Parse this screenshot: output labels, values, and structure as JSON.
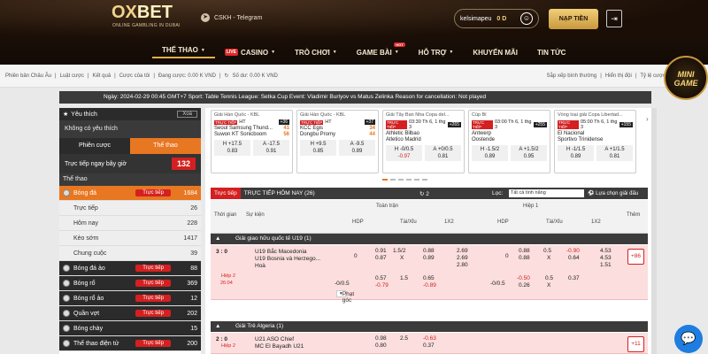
{
  "header": {
    "logo_a": "OX",
    "logo_b": "BET",
    "logo_sub": "ONLINE GAMBLING IN DUBAI",
    "telegram": "CSKH - Telegram",
    "username": "kelsimapeu",
    "balance": "0 D",
    "deposit": "NẠP TIỀN"
  },
  "nav": [
    {
      "label": "THỂ THAO"
    },
    {
      "label": "CASINO",
      "badge": "LIVE"
    },
    {
      "label": "TRÒ CHƠI"
    },
    {
      "label": "GAME BÀI",
      "badge": "HOT"
    },
    {
      "label": "HỖ TRỢ"
    },
    {
      "label": "KHUYẾN MÃI"
    },
    {
      "label": "TIN TỨC"
    }
  ],
  "subbar": {
    "left": [
      "Phiên bản Châu Âu",
      "Luật cược",
      "Kết quả",
      "Cược của tôi",
      "Đang cược: 0.00 K VND",
      "Số dư: 0.00 K VND"
    ],
    "right": [
      "Sắp xếp bình thường",
      "Hiển thị đội",
      "Tỷ lệ cược"
    ]
  },
  "minigame": "MINI GAME",
  "marquee": "Ngày:  2024-02-29 00:45 GMT+7 Sport: Table Tennis League: Setka Cup Event: Vladimir Burlyov vs Matus Zelinka Reason for cancellation: Not played",
  "sidebar": {
    "fav": "Yêu thích",
    "clear": "Xoá",
    "nofav": "Không có yêu thích",
    "tab1": "Phiên cược",
    "tab2": "Thể thao",
    "live_now": "Trực tiếp ngay bây giờ",
    "live_count": "132",
    "sports_title": "Thể thao",
    "items": [
      {
        "label": "Bóng đá",
        "tag": "Trực tiếp",
        "count": "1684",
        "sel": true
      },
      {
        "label": "Trực tiếp",
        "count": "26",
        "w": true
      },
      {
        "label": "Hôm nay",
        "count": "228",
        "w": true
      },
      {
        "label": "Kèo sớm",
        "count": "1417",
        "w": true
      },
      {
        "label": "Chung cuộc",
        "count": "39",
        "w": true
      },
      {
        "label": "Bóng đá ảo",
        "tag": "Trực tiếp",
        "count": "88"
      },
      {
        "label": "Bóng rổ",
        "tag": "Trực tiếp",
        "count": "369"
      },
      {
        "label": "Bóng rổ ảo",
        "tag": "Trực tiếp",
        "count": "12"
      },
      {
        "label": "Quần vợt",
        "tag": "Trực tiếp",
        "count": "202"
      },
      {
        "label": "Bóng chày",
        "count": "15"
      },
      {
        "label": "Thể thao điện tử",
        "tag": "Trực tiếp",
        "count": "200"
      }
    ]
  },
  "cards": [
    {
      "league": "Giải Hàn Quốc - KBL",
      "meta": "HT",
      "cnt": "+36",
      "t1": "Seoul Samsung Thund...",
      "s1": "41",
      "t2": "Suwon KT Sonicboom",
      "s2": "56",
      "o1a": "H +17.5",
      "o1b": "0.83",
      "o2a": "A -17.5",
      "o2b": "0.91"
    },
    {
      "league": "Giải Hàn Quốc - KBL",
      "meta": "HT",
      "cnt": "+37",
      "t1": "KCC Egis",
      "s1": "34",
      "t2": "Dongbu Promy",
      "s2": "44",
      "o1a": "H +9.5",
      "o1b": "0.85",
      "o2a": "A -9.5",
      "o2b": "0.89"
    },
    {
      "league": "Giải Tây Ban Nha Copa del...",
      "meta": "03:30 Th 6, 1 thg 3",
      "cnt": "+265",
      "t1": "Athletic Bilbao",
      "s1": "",
      "t2": "Atletico Madrid",
      "s2": "",
      "o1a": "H -0/0.5",
      "o1b": "-0.97",
      "o2a": "A +0/0.5",
      "o2b": "0.81"
    },
    {
      "league": "Cúp Bỉ",
      "meta": "03:00 Th 6, 1 thg 3",
      "cnt": "+255",
      "t1": "Antwerp",
      "s1": "",
      "t2": "Oostende",
      "s2": "",
      "o1a": "H -1.5/2",
      "o1b": "0.89",
      "o2a": "A +1.5/2",
      "o2b": "0.95"
    },
    {
      "league": "Vòng loại giải Copa Libertad...",
      "meta": "05:00 Th 6, 1 thg 3",
      "cnt": "+155",
      "t1": "El Nacional",
      "s1": "",
      "t2": "Sportivo Trinidense",
      "s2": "",
      "o1a": "H -1/1.5",
      "o1b": "0.89",
      "o2a": "A +1/1.5",
      "o2b": "0.81"
    }
  ],
  "bar": {
    "tag": "Trực tiếp",
    "title": "TRỰC TIẾP HÔM NAY (26)",
    "refresh": "2",
    "filter_label": "Lọc:",
    "filter_val": "Tất cả tình năng",
    "choose": "Lựa chọn giải đấu"
  },
  "table": {
    "time": "Thời gian",
    "event": "Sự kiện",
    "full": "Toàn trận",
    "half": "Hiệp 1",
    "hdp": "HDP",
    "ou": "Tài/Xỉu",
    "x12": "1X2",
    "more": "Thêm"
  },
  "leagues": [
    {
      "name": "Giải giao hữu quốc tế U19 (1)"
    },
    {
      "name": "Giải Trẻ Algeria (1)"
    }
  ],
  "match1": {
    "score": "3 : 0",
    "half": "Hiệp 2",
    "time": "26:04",
    "t1": "U19 Bắc Macedonia",
    "t2": "U19 Bosnia và Herzego...",
    "draw": "Hoà",
    "a1": "0",
    "a2": "0.91",
    "a3": "0.87",
    "b1": "1.5/2",
    "b2": "X",
    "c1": "0.88",
    "c2": "0.89",
    "d1": "2.69",
    "d2": "2.69",
    "d3": "2.80",
    "e1": "0",
    "e2": "0.88",
    "e3": "0.88",
    "f1": "0.5",
    "f2": "X",
    "g1": "-0.90",
    "g2": "0.64",
    "h1": "4.53",
    "h2": "4.53",
    "h3": "1.51",
    "r2a": "-0/0.5",
    "r2b": "0.57",
    "r2c": "-0.79",
    "r2d": "1.5",
    "r2e": "0.65",
    "r2f": "-0.89",
    "r2g": "-0/0.5",
    "r2h": "-0.50",
    "r2i": "0.26",
    "r2j": "0.5",
    "r2k": "0.37",
    "r2l": "X",
    "plus": "+86",
    "more": "Phạt góc"
  },
  "match2": {
    "score": "2 : 0",
    "half": "Hiệp 2",
    "time": "22:40",
    "t1": "U21 ASO Chief",
    "t2": "MC El Bayadh U21",
    "a2": "0.98",
    "a3": "0.80",
    "b1": "2.5",
    "c1": "-0.63",
    "c2": "0.37",
    "plus": "+11"
  }
}
